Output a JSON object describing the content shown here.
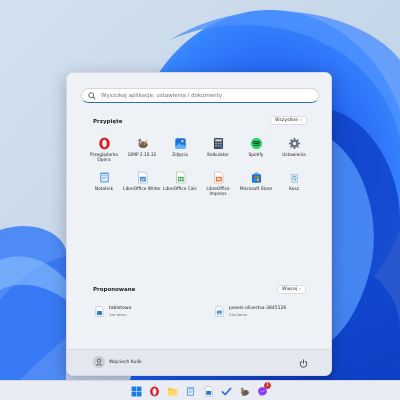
{
  "search": {
    "placeholder": "Wyszukaj aplikacje, ustawienia i dokumenty"
  },
  "pinned": {
    "title": "Przypięte",
    "all_button": "Wszystkie",
    "apps": [
      {
        "label": "Przeglądarka Opera",
        "icon": "opera-icon"
      },
      {
        "label": "GIMP 2.10.32",
        "icon": "gimp-icon"
      },
      {
        "label": "Zdjęcia",
        "icon": "photos-icon"
      },
      {
        "label": "Kalkulator",
        "icon": "calculator-icon"
      },
      {
        "label": "Spotify",
        "icon": "spotify-icon"
      },
      {
        "label": "Ustawienia",
        "icon": "settings-gear-icon"
      },
      {
        "label": "Notatnik",
        "icon": "notepad-icon"
      },
      {
        "label": "LibreOffice Writer",
        "icon": "libreoffice-writer-icon"
      },
      {
        "label": "LibreOffice Calc",
        "icon": "libreoffice-calc-icon"
      },
      {
        "label": "LibreOffice Impress",
        "icon": "libreoffice-impress-icon"
      },
      {
        "label": "Microsoft Store",
        "icon": "microsoft-store-icon"
      },
      {
        "label": "Kosz",
        "icon": "recycle-bin-icon"
      }
    ]
  },
  "recommended": {
    "title": "Proponowane",
    "more_button": "Więcej",
    "items": [
      {
        "name": "tabletowo",
        "time": "1m temu",
        "icon": "document-icon"
      },
      {
        "name": "pexels-olivertsa-3845126",
        "time": "22s temu",
        "icon": "image-file-icon"
      }
    ]
  },
  "user": {
    "name": "Wojciech Kulik"
  },
  "taskbar": {
    "icons": [
      "windows-start-icon",
      "opera-icon",
      "file-explorer-icon",
      "notepad-icon",
      "libreoffice-writer-icon",
      "todo-icon",
      "gimp-icon",
      "messenger-icon"
    ],
    "badge": "1"
  },
  "colors": {
    "accent": "#2b6cc4",
    "menu_bg": "#eef1f5",
    "taskbar_bg": "#e9edf3"
  }
}
